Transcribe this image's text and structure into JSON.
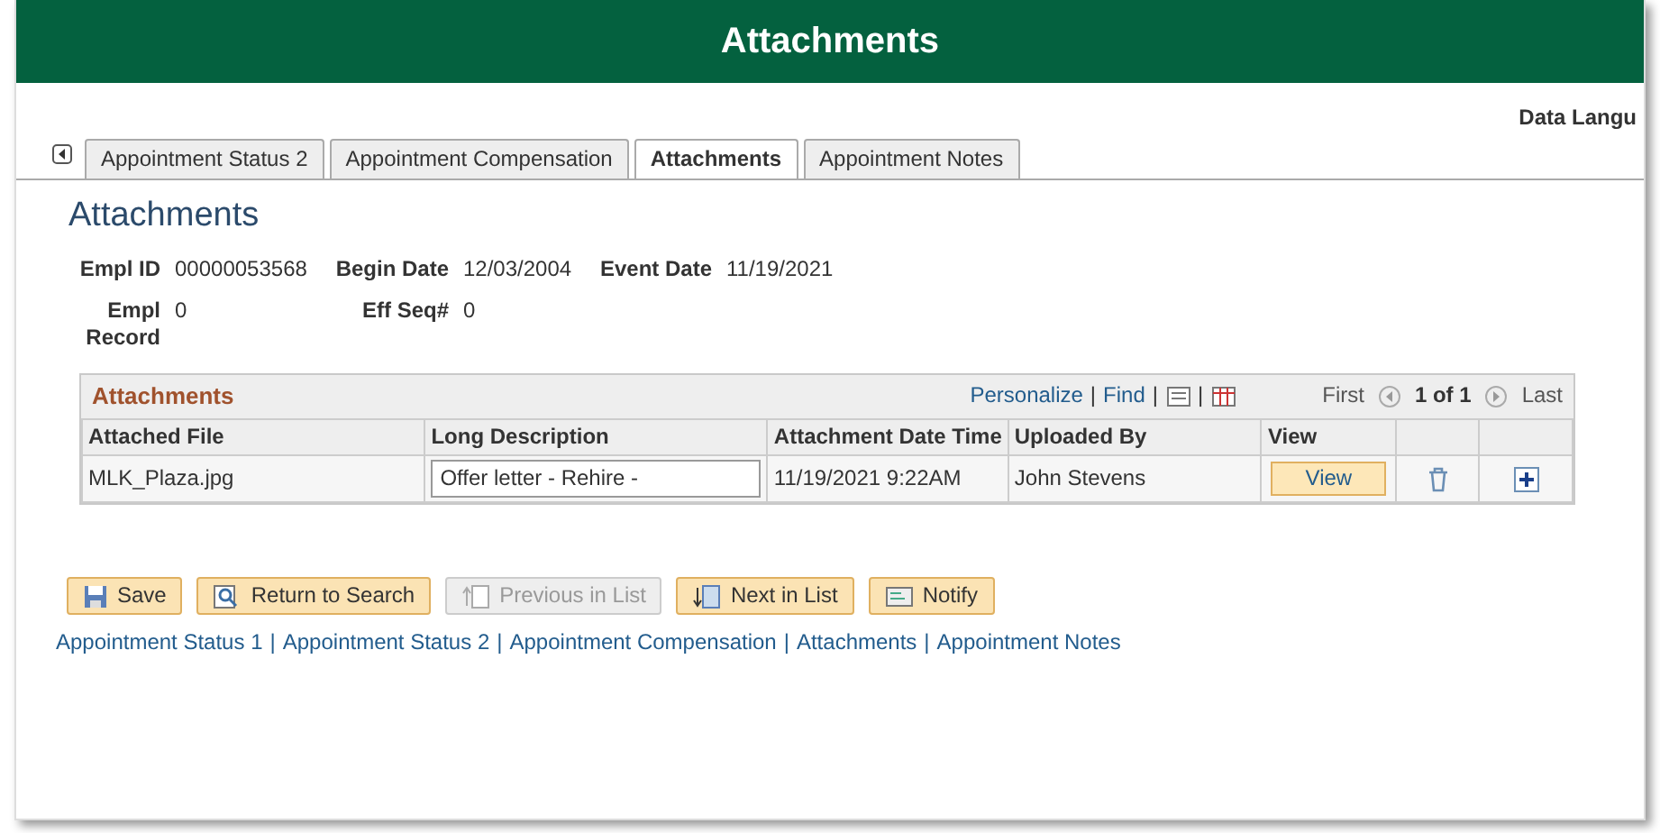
{
  "header": {
    "title": "Attachments"
  },
  "data_language": "Data Langu",
  "tabs": [
    {
      "label": "Appointment Status 2",
      "selected": false
    },
    {
      "label": "Appointment Compensation",
      "selected": false
    },
    {
      "label": "Attachments",
      "selected": true
    },
    {
      "label": "Appointment Notes",
      "selected": false
    }
  ],
  "page_title": "Attachments",
  "fields": [
    {
      "label": "Empl ID",
      "value": "00000053568"
    },
    {
      "label": "Begin Date",
      "value": "12/03/2004"
    },
    {
      "label": "Event Date",
      "value": "11/19/2021"
    },
    {
      "label": "Empl Record",
      "value": "0"
    },
    {
      "label": "Eff Seq#",
      "value": "0"
    }
  ],
  "grid": {
    "title": "Attachments",
    "personalize": "Personalize",
    "separators": [
      "|",
      "|",
      "|"
    ],
    "find": "Find",
    "first": "First",
    "count": "1 of 1",
    "last": "Last",
    "columns": [
      "Attached File",
      "Long Description",
      "Attachment Date Time",
      "Uploaded By",
      "View"
    ],
    "rows": [
      {
        "file": "MLK_Plaza.jpg",
        "description": "Offer letter - Rehire -",
        "datetime": "11/19/2021  9:22AM",
        "uploaded_by": "John Stevens",
        "view": "View"
      }
    ]
  },
  "buttons": [
    {
      "label": "Save",
      "disabled": false
    },
    {
      "label": "Return to Search",
      "disabled": false
    },
    {
      "label": "Previous in List",
      "disabled": true
    },
    {
      "label": "Next in List",
      "disabled": false
    },
    {
      "label": "Notify",
      "disabled": false
    }
  ],
  "link_separators": [
    "|",
    "|",
    "|",
    "|"
  ],
  "links": [
    "Appointment Status 1",
    "Appointment Status 2",
    "Appointment Compensation",
    "Attachments",
    "Appointment Notes"
  ]
}
